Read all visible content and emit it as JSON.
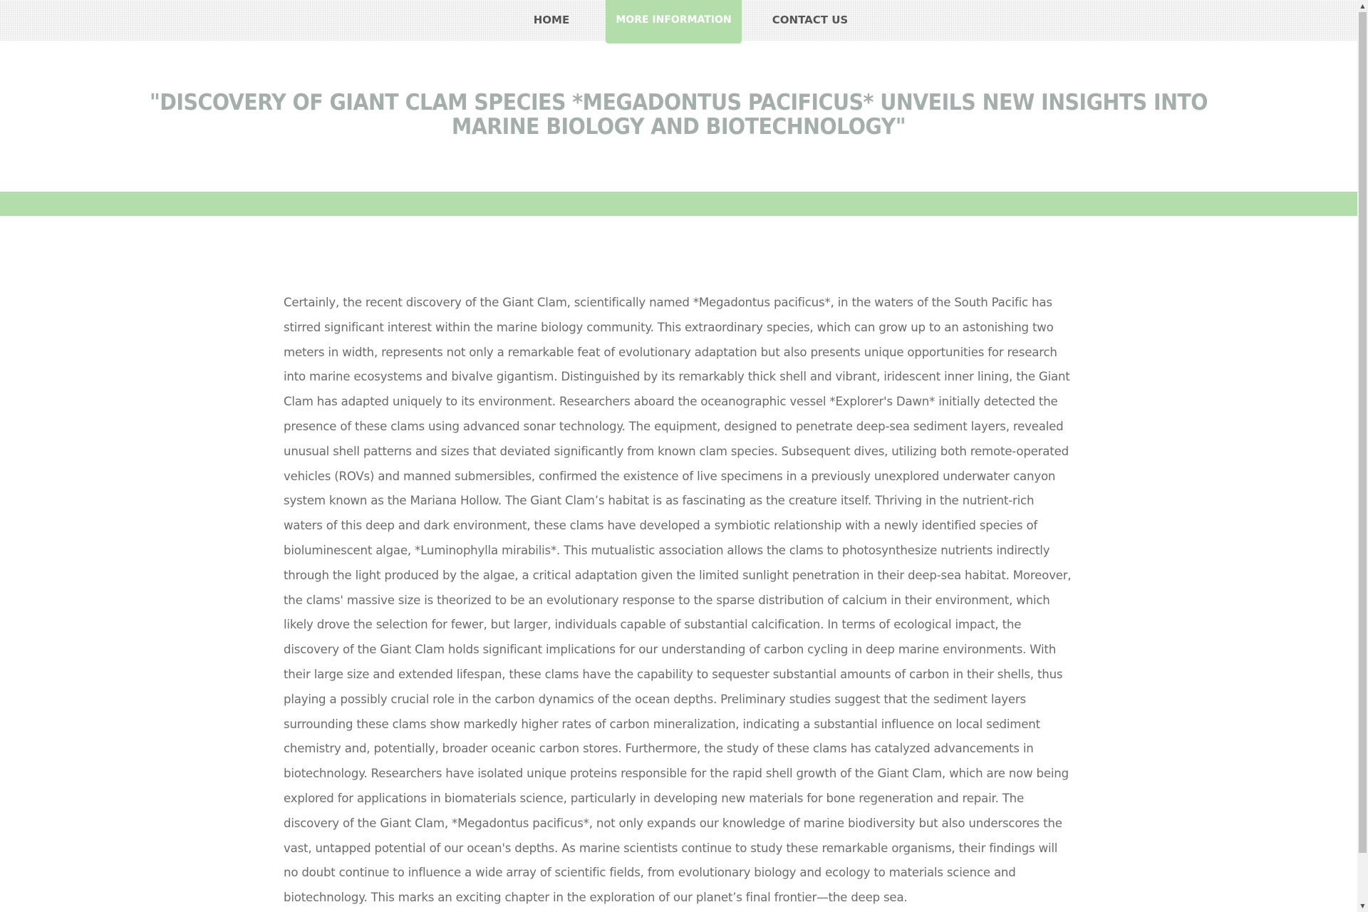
{
  "nav": {
    "items": [
      {
        "label": "HOME"
      },
      {
        "label": "MORE INFORMATION",
        "active": true
      },
      {
        "label": "CONTACT US"
      }
    ],
    "active_color": "#b3deac"
  },
  "headline": "\"DISCOVERY OF GIANT CLAM SPECIES *MEGADONTUS PACIFICUS* UNVEILS NEW INSIGHTS INTO MARINE BIOLOGY AND BIOTECHNOLOGY\"",
  "article": {
    "body": "Certainly, the recent discovery of the Giant Clam, scientifically named *Megadontus pacificus*, in the waters of the South Pacific has stirred significant interest within the marine biology community. This extraordinary species, which can grow up to an astonishing two meters in width, represents not only a remarkable feat of evolutionary adaptation but also presents unique opportunities for research into marine ecosystems and bivalve gigantism. Distinguished by its remarkably thick shell and vibrant, iridescent inner lining, the Giant Clam has adapted uniquely to its environment. Researchers aboard the oceanographic vessel *Explorer's Dawn* initially detected the presence of these clams using advanced sonar technology. The equipment, designed to penetrate deep-sea sediment layers, revealed unusual shell patterns and sizes that deviated significantly from known clam species. Subsequent dives, utilizing both remote-operated vehicles (ROVs) and manned submersibles, confirmed the existence of live specimens in a previously unexplored underwater canyon system known as the Mariana Hollow. The Giant Clam’s habitat is as fascinating as the creature itself. Thriving in the nutrient-rich waters of this deep and dark environment, these clams have developed a symbiotic relationship with a newly identified species of bioluminescent algae, *Luminophylla mirabilis*. This mutualistic association allows the clams to photosynthesize nutrients indirectly through the light produced by the algae, a critical adaptation given the limited sunlight penetration in their deep-sea habitat. Moreover, the clams' massive size is theorized to be an evolutionary response to the sparse distribution of calcium in their environment, which likely drove the selection for fewer, but larger, individuals capable of substantial calcification. In terms of ecological impact, the discovery of the Giant Clam holds significant implications for our understanding of carbon cycling in deep marine environments. With their large size and extended lifespan, these clams have the capability to sequester substantial amounts of carbon in their shells, thus playing a possibly crucial role in the carbon dynamics of the ocean depths. Preliminary studies suggest that the sediment layers surrounding these clams show markedly higher rates of carbon mineralization, indicating a substantial influence on local sediment chemistry and, potentially, broader oceanic carbon stores. Furthermore, the study of these clams has catalyzed advancements in biotechnology. Researchers have isolated unique proteins responsible for the rapid shell growth of the Giant Clam, which are now being explored for applications in biomaterials science, particularly in developing new materials for bone regeneration and repair. The discovery of the Giant Clam, *Megadontus pacificus*, not only expands our knowledge of marine biodiversity but also underscores the vast, untapped potential of our ocean's depths. As marine scientists continue to study these remarkable organisms, their findings will no doubt continue to influence a wide array of scientific fields, from evolutionary biology and ecology to materials science and biotechnology. This marks an exciting chapter in the exploration of our planet’s final frontier—the deep sea."
  },
  "colors": {
    "accent_green": "#b3deac",
    "headline_gray": "#a4aeab",
    "body_text": "#6b6b6b"
  },
  "scrollbar": {
    "up_icon": "▲",
    "down_icon": "▼"
  }
}
